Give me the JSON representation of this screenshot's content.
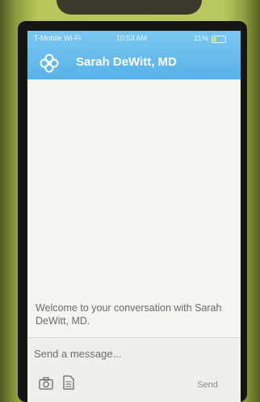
{
  "status_bar": {
    "carrier": "T-Mobile Wi-Fi",
    "time": "10:53 AM",
    "battery": "21%"
  },
  "header": {
    "title": "Sarah DeWitt, MD",
    "logo_icon": "clover-knot-icon"
  },
  "conversation": {
    "welcome_text": "Welcome to your conversation with Sarah DeWitt, MD."
  },
  "composer": {
    "placeholder": "Send a message...",
    "send_label": "Send",
    "attach_icons": [
      "camera-icon",
      "document-icon"
    ]
  },
  "colors": {
    "header_blue": "#56b2e8",
    "case_green": "#b7c55a"
  }
}
